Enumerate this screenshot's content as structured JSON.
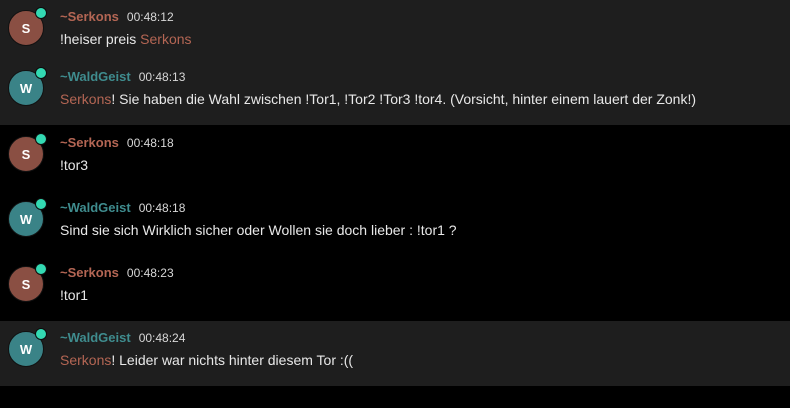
{
  "colors": {
    "serkons": "#b46654",
    "waldgeist": "#3f8c8e",
    "serkons_avatar": "#8a4f43",
    "waldgeist_avatar": "#3a8387",
    "online": "#33d9b2",
    "row_alt": "#1e1e1e",
    "row": "#000000"
  },
  "messages": [
    {
      "user": "~Serkons",
      "initial": "S",
      "time": "00:48:12",
      "mention": "",
      "text_before": "!heiser preis ",
      "text_mention_after": "Serkons",
      "avatar_icon": "user-avatar",
      "status_icon": "online-status-dot"
    },
    {
      "user": "~WaldGeist",
      "initial": "W",
      "time": "00:48:13",
      "mention": "Serkons",
      "text": "! Sie haben die Wahl zwischen !Tor1, !Tor2 !Tor3 !tor4. (Vorsicht, hinter einem lauert der Zonk!)"
    },
    {
      "user": "~Serkons",
      "initial": "S",
      "time": "00:48:18",
      "mention": "",
      "text": "!tor3"
    },
    {
      "user": "~WaldGeist",
      "initial": "W",
      "time": "00:48:18",
      "mention": "",
      "text": "Sind sie sich Wirklich sicher oder Wollen sie doch lieber : !tor1 ?"
    },
    {
      "user": "~Serkons",
      "initial": "S",
      "time": "00:48:23",
      "mention": "",
      "text": "!tor1"
    },
    {
      "user": "~WaldGeist",
      "initial": "W",
      "time": "00:48:24",
      "mention": "Serkons",
      "text": "! Leider war nichts hinter diesem Tor :(("
    }
  ]
}
